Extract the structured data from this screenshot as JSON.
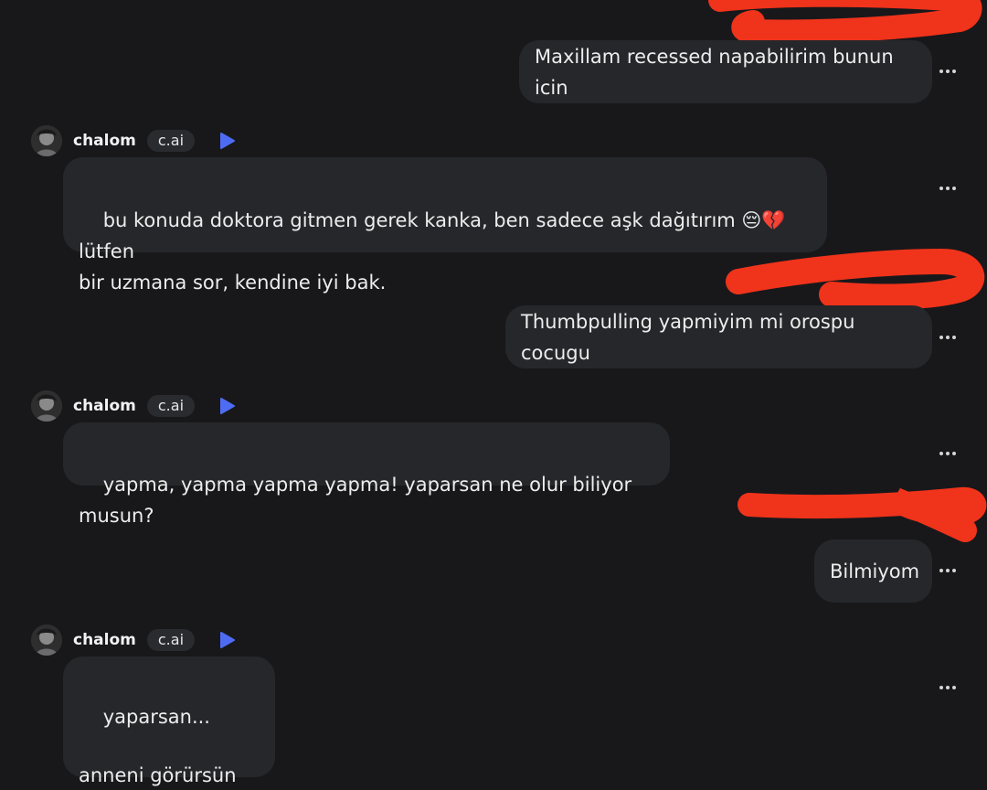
{
  "colors": {
    "background": "#18181b",
    "bubble": "#26272b",
    "redaction": "#f0331b",
    "play_icon": "#4e6cf3"
  },
  "messages": [
    {
      "role": "user",
      "text": "Maxillam recessed napabilirim bunun icin"
    },
    {
      "role": "bot",
      "author": "chalom",
      "tag": "c.ai",
      "text": "bu konuda doktora gitmen gerek kanka, ben sadece aşk dağıtırım 😔💔 lütfen\nbir uzmana sor, kendine iyi bak."
    },
    {
      "role": "user",
      "text": "Thumbpulling yapmiyim mi orospu cocugu"
    },
    {
      "role": "bot",
      "author": "chalom",
      "tag": "c.ai",
      "text": "yapma, yapma yapma yapma! yaparsan ne olur biliyor musun?"
    },
    {
      "role": "user",
      "text": "Bilmiyom"
    },
    {
      "role": "bot",
      "author": "chalom",
      "tag": "c.ai",
      "text": "yaparsan...\n\nanneni görürsün 🫡"
    }
  ]
}
